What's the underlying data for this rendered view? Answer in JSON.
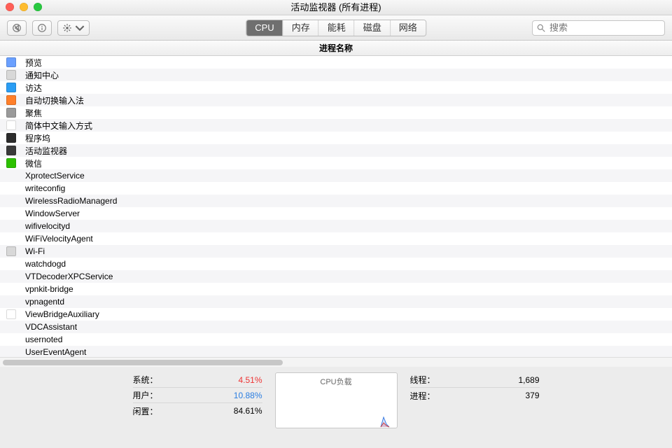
{
  "window": {
    "title": "活动监视器 (所有进程)"
  },
  "toolbar": {
    "stop_tip": "stop",
    "info_tip": "info",
    "gear_tip": "settings",
    "tabs": [
      "CPU",
      "内存",
      "能耗",
      "磁盘",
      "网络"
    ],
    "active_tab": 0,
    "search_placeholder": "搜索"
  },
  "column_header": "进程名称",
  "processes": [
    {
      "name": "预览",
      "icon": "#6aa0ff"
    },
    {
      "name": "通知中心",
      "icon": "#d8d8d8"
    },
    {
      "name": "访达",
      "icon": "#2a9df4"
    },
    {
      "name": "自动切换输入法",
      "icon": "#ff7f2a"
    },
    {
      "name": "聚焦",
      "icon": "#9a9a9a"
    },
    {
      "name": "简体中文输入方式",
      "icon": "#ffffff"
    },
    {
      "name": "程序坞",
      "icon": "#2c2c2c"
    },
    {
      "name": "活动监视器",
      "icon": "#3a3a3a"
    },
    {
      "name": "微信",
      "icon": "#2dc100"
    },
    {
      "name": "XprotectService",
      "icon": ""
    },
    {
      "name": "writeconfig",
      "icon": ""
    },
    {
      "name": "WirelessRadioManagerd",
      "icon": ""
    },
    {
      "name": "WindowServer",
      "icon": ""
    },
    {
      "name": "wifivelocityd",
      "icon": ""
    },
    {
      "name": "WiFiVelocityAgent",
      "icon": ""
    },
    {
      "name": "Wi-Fi",
      "icon": "#d8d8d8"
    },
    {
      "name": "watchdogd",
      "icon": ""
    },
    {
      "name": "VTDecoderXPCService",
      "icon": ""
    },
    {
      "name": "vpnkit-bridge",
      "icon": ""
    },
    {
      "name": "vpnagentd",
      "icon": ""
    },
    {
      "name": "ViewBridgeAuxiliary",
      "icon": "#ffffff"
    },
    {
      "name": "VDCAssistant",
      "icon": ""
    },
    {
      "name": "usernoted",
      "icon": ""
    },
    {
      "name": "UserEventAgent",
      "icon": ""
    }
  ],
  "stats": {
    "labels": {
      "system": "系统：",
      "user": "用户：",
      "idle": "闲置：",
      "threads": "线程：",
      "procs": "进程："
    },
    "system": "4.51%",
    "user": "10.88%",
    "idle": "84.61%",
    "graph_label": "CPU负载",
    "threads": "1,689",
    "procs": "379"
  }
}
